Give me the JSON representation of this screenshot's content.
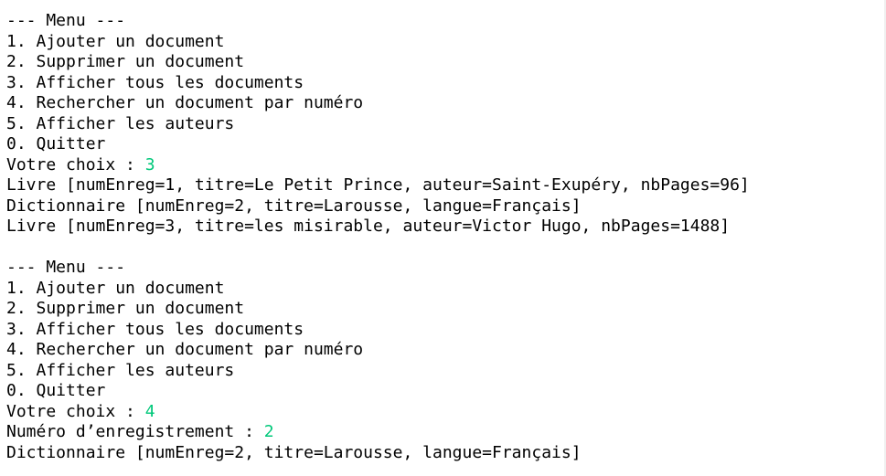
{
  "block1": {
    "menu_title": "--- Menu ---",
    "options": [
      "1. Ajouter un document",
      "2. Supprimer un document",
      "3. Afficher tous les documents",
      "4. Rechercher un document par numéro",
      "5. Afficher les auteurs",
      "0. Quitter"
    ],
    "prompt": "Votre choix : ",
    "input": "3",
    "results": [
      "Livre [numEnreg=1, titre=Le Petit Prince, auteur=Saint-Exupéry, nbPages=96]",
      "Dictionnaire [numEnreg=2, titre=Larousse, langue=Français]",
      "Livre [numEnreg=3, titre=les misirable, auteur=Victor Hugo, nbPages=1488]"
    ]
  },
  "block2": {
    "menu_title": "--- Menu ---",
    "options": [
      "1. Ajouter un document",
      "2. Supprimer un document",
      "3. Afficher tous les documents",
      "4. Rechercher un document par numéro",
      "5. Afficher les auteurs",
      "0. Quitter"
    ],
    "prompt": "Votre choix : ",
    "input": "4",
    "number_prompt": "Numéro d’enregistrement : ",
    "number_input": "2",
    "result": "Dictionnaire [numEnreg=2, titre=Larousse, langue=Français]"
  },
  "colors": {
    "background": "#ffffff",
    "text": "#000000",
    "user_input": "#00c87a"
  }
}
